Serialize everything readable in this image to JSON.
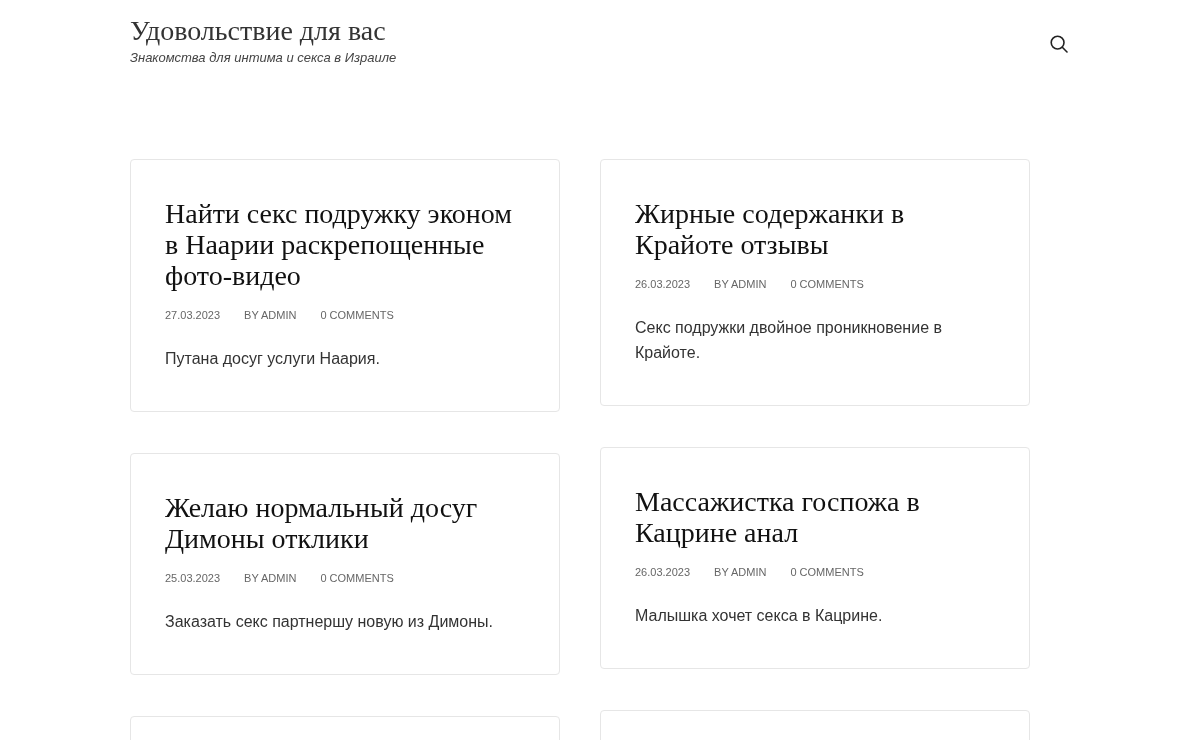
{
  "site": {
    "title": "Удовольствие для вас",
    "tagline": "Знакомства для интима и секса в Израиле"
  },
  "columns": [
    {
      "posts": [
        {
          "title": "Найти секс подружку эконом в Наарии раскрепощенные фото-видео",
          "date": "27.03.2023",
          "author": "BY ADMIN",
          "comments": "0 COMMENTS",
          "excerpt": "Путана досуг услуги Наария."
        },
        {
          "title": "Желаю нормальный досуг Димоны отклики",
          "date": "25.03.2023",
          "author": "BY ADMIN",
          "comments": "0 COMMENTS",
          "excerpt": "Заказать секс партнершу новую из Димоны."
        }
      ],
      "more_posts_below": true
    },
    {
      "posts": [
        {
          "title": "Жирные содержанки в Крайоте отзывы",
          "date": "26.03.2023",
          "author": "BY ADMIN",
          "comments": "0 COMMENTS",
          "excerpt": "Секс подружки двойное проникновение в Крайоте."
        },
        {
          "title": "Массажистка госпожа в Кацрине анал",
          "date": "26.03.2023",
          "author": "BY ADMIN",
          "comments": "0 COMMENTS",
          "excerpt": "Малышка хочет секса в Кацрине."
        }
      ],
      "more_posts_below": true
    }
  ]
}
